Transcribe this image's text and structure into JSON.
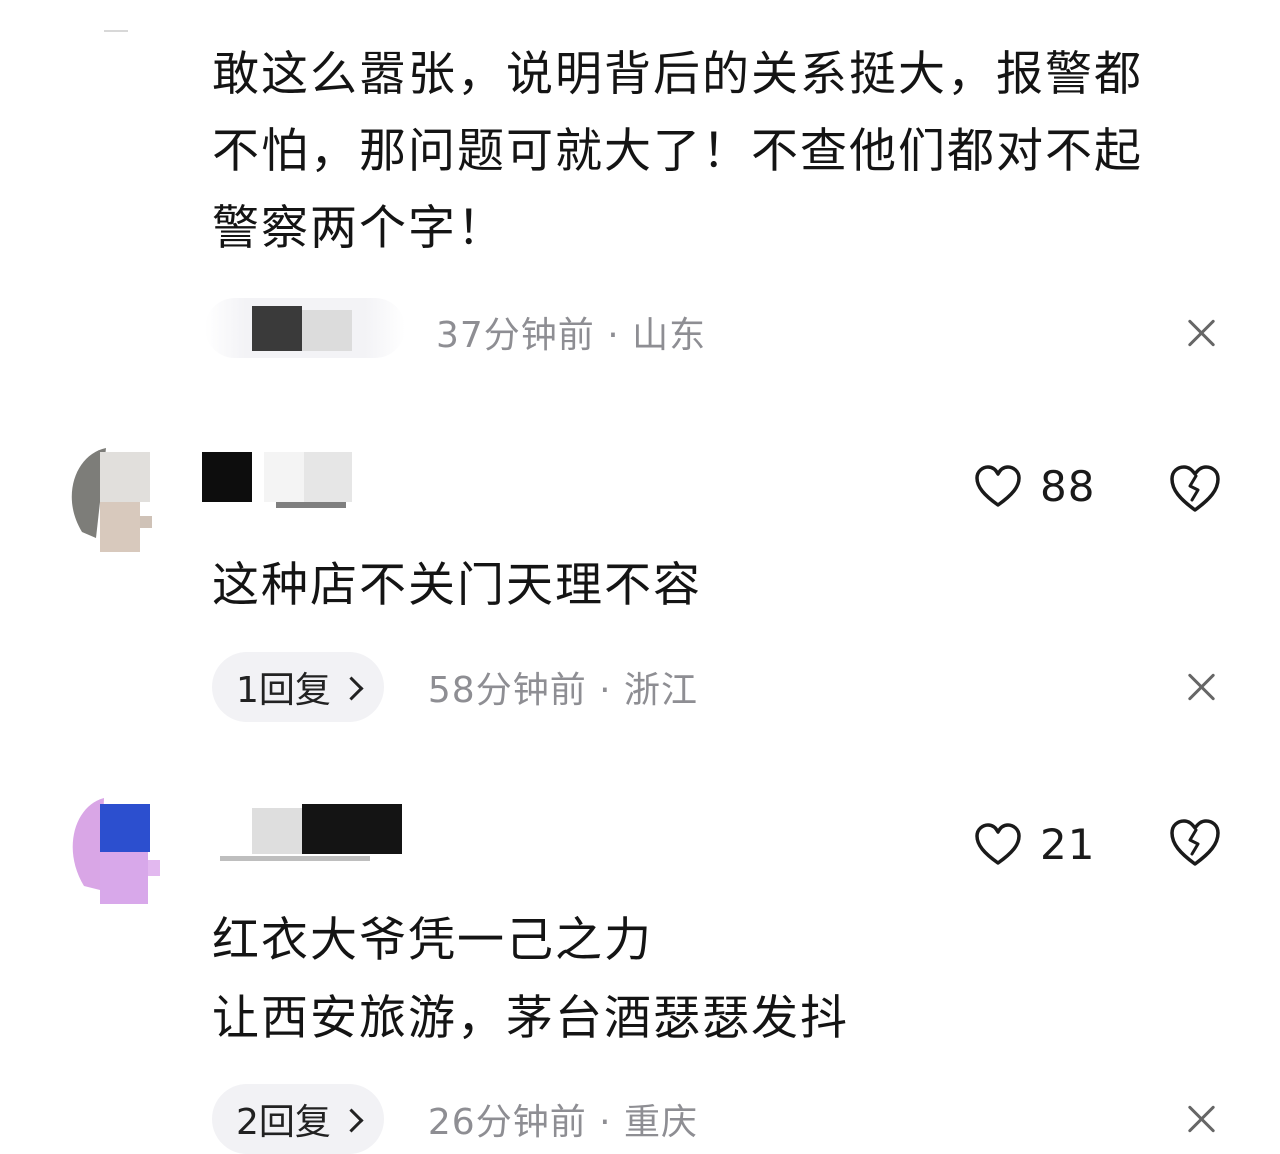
{
  "comments": [
    {
      "text_lines": [
        "敢这么嚣张，说明背后的关系挺大，报警都",
        "不怕，那问题可就大了！不查他们都对不起",
        "警察两个字！"
      ],
      "time": "37分钟前",
      "location": "山东",
      "meta": "37分钟前 · 山东"
    },
    {
      "likes": "88",
      "text_lines": [
        "这种店不关门天理不容"
      ],
      "reply_label": "1回复",
      "time": "58分钟前",
      "location": "浙江",
      "meta": "58分钟前 · 浙江"
    },
    {
      "likes": "21",
      "text_lines": [
        "红衣大爷凭一己之力",
        "让西安旅游，茅台酒瑟瑟发抖"
      ],
      "reply_label": "2回复",
      "time": "26分钟前",
      "location": "重庆",
      "meta": "26分钟前 · 重庆"
    }
  ],
  "icons": {
    "like": "heart-outline-icon",
    "dislike": "broken-heart-icon",
    "close": "close-icon",
    "chevron": "chevron-right-icon"
  },
  "colors": {
    "meta_text": "#8e8e93",
    "reply_pill_bg": "#f2f2f5"
  }
}
